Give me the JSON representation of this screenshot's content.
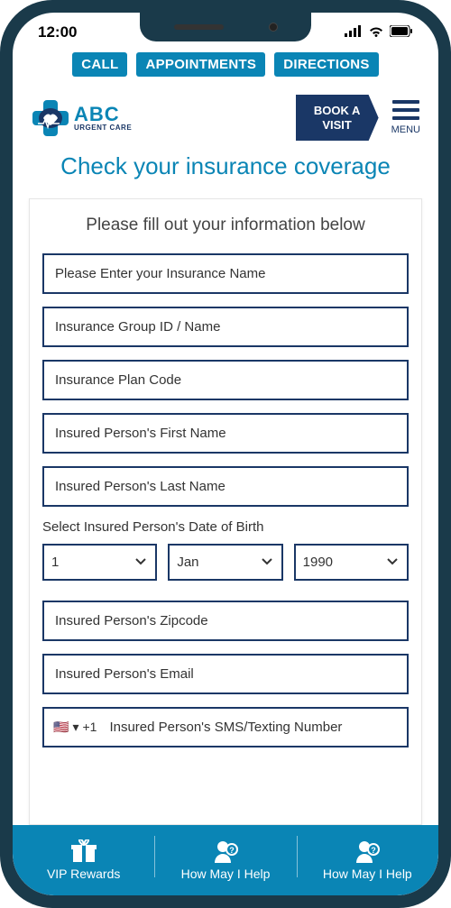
{
  "status": {
    "time": "12:00"
  },
  "topnav": {
    "call": "CALL",
    "appointments": "APPOINTMENTS",
    "directions": "DIRECTIONS"
  },
  "logo": {
    "main": "ABC",
    "sub": "URGENT CARE"
  },
  "header": {
    "book": "BOOK A VISIT",
    "menu": "MENU"
  },
  "title": "Check your insurance coverage",
  "form": {
    "heading": "Please fill out your information below",
    "ins_name": "Please Enter your Insurance Name",
    "group_id": "Insurance Group ID / Name",
    "plan_code": "Insurance Plan Code",
    "first_name": "Insured Person's First Name",
    "last_name": "Insured Person's Last Name",
    "dob_label": "Select Insured Person's Date of Birth",
    "dob_day": "1",
    "dob_month": "Jan",
    "dob_year": "1990",
    "zipcode": "Insured Person's Zipcode",
    "email": "Insured Person's Email",
    "cc": "+1",
    "phone": "Insured Person's SMS/Texting Number"
  },
  "bottom": {
    "rewards": "VIP Rewards",
    "help1": "How May I Help",
    "help2": "How May I Help"
  }
}
